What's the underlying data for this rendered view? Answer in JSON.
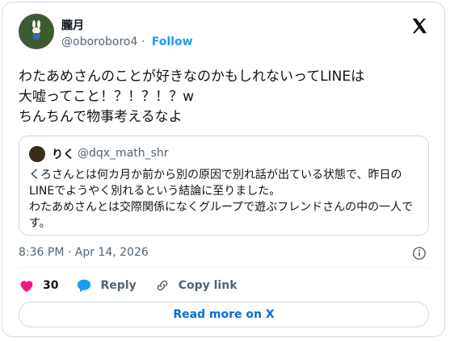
{
  "author": {
    "display_name": "朧月",
    "handle": "@oboroboro4",
    "separator": "·",
    "follow_label": "Follow"
  },
  "tweet": {
    "text": "わたあめさんのことが好きなのかもしれないってLINEは\n大嘘ってこと！？！？！？w\nちんちんで物事考えるなよ"
  },
  "quoted": {
    "display_name": "りく",
    "handle": "@dqx_math_shr",
    "text": "くろさんとは何カ月か前から別の原因で別れ話が出ている状態で、昨日のLINEでようやく別れるという結論に至りました。\nわたあめさんとは交際関係になくグループで遊ぶフレンドさんの中の一人です。"
  },
  "timestamp": "8:36 PM · Apr 14, 2026",
  "actions": {
    "likes_count": "30",
    "reply_label": "Reply",
    "copy_link_label": "Copy link"
  },
  "read_more_label": "Read more on X",
  "icons": [
    "x-logo-icon",
    "info-icon",
    "heart-icon",
    "reply-icon",
    "link-icon"
  ],
  "colors": {
    "accent": "#1d9bf0",
    "like": "#f91880",
    "link_text": "#006fd6"
  }
}
